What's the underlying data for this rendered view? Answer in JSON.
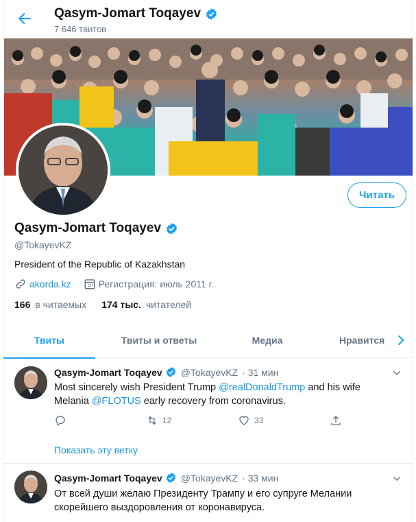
{
  "header": {
    "back_icon": "arrow-left-icon",
    "name": "Qasym-Jomart Toqayev",
    "tweet_count": "7 646 твитов"
  },
  "profile": {
    "name": "Qasym-Jomart Toqayev",
    "handle": "@TokayevKZ",
    "bio": "President of the Republic of Kazakhstan",
    "website": "akorda.kz",
    "joined": "Регистрация: июль 2011 г.",
    "following_count": "166",
    "following_label": "в читаемых",
    "followers_count": "174 тыс.",
    "followers_label": "читателей",
    "follow_button": "Читать"
  },
  "tabs": [
    {
      "label": "Твиты",
      "active": true
    },
    {
      "label": "Твиты и ответы",
      "active": false
    },
    {
      "label": "Медиа",
      "active": false
    },
    {
      "label": "Нравится",
      "active": false
    }
  ],
  "tweets": [
    {
      "name": "Qasym-Jomart Toqayev",
      "handle": "@TokayevKZ",
      "time": "· 31 мин",
      "text_parts": {
        "p1": "Most sincerely wish President Trump ",
        "m1": "@realDonaldTrump",
        "p2": " and his wife",
        "p3": "Melania ",
        "m2": "@FLOTUS",
        "p4": " early recovery from coronavirus."
      },
      "retweets": "12",
      "likes": "33",
      "thread_link": "Показать эту ветку"
    },
    {
      "name": "Qasym-Jomart Toqayev",
      "handle": "@TokayevKZ",
      "time": "· 33 мин",
      "line1": "От всей души желаю Президенту Трампу и его супруге Мелании",
      "line2": "скорейшего выздоровления от коронавируса."
    }
  ],
  "colors": {
    "accent": "#1da1f2",
    "link": "#1b95e0",
    "muted": "#657786",
    "text": "#14171a"
  }
}
